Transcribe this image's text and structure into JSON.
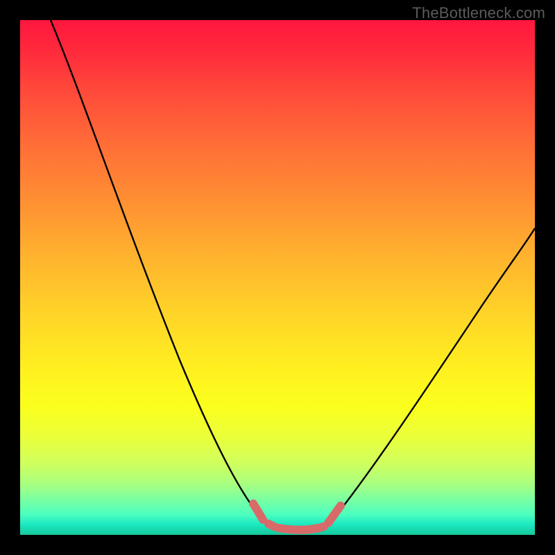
{
  "watermark": "TheBottleneck.com",
  "colors": {
    "curve_stroke": "#000000",
    "marker_stroke": "#d86a6a",
    "background": "#000000"
  },
  "chart_data": {
    "type": "line",
    "title": "",
    "xlabel": "",
    "ylabel": "",
    "xlim": [
      0,
      100
    ],
    "ylim": [
      0,
      100
    ],
    "grid": false,
    "series": [
      {
        "name": "left-curve",
        "x": [
          6,
          10,
          15,
          20,
          25,
          30,
          35,
          40,
          45,
          48
        ],
        "y": [
          100,
          89,
          78,
          67,
          55,
          43,
          31,
          19,
          7,
          2
        ]
      },
      {
        "name": "bottom-flat",
        "x": [
          48,
          52,
          56,
          60
        ],
        "y": [
          2,
          1.5,
          1.5,
          2
        ]
      },
      {
        "name": "right-curve",
        "x": [
          60,
          65,
          70,
          75,
          80,
          85,
          90,
          95,
          100
        ],
        "y": [
          2,
          8,
          15,
          22,
          30,
          38,
          46,
          53,
          60
        ]
      }
    ],
    "markers": [
      {
        "segment": "left-end",
        "x": [
          46,
          47,
          48
        ],
        "y": [
          5,
          3.5,
          2
        ]
      },
      {
        "segment": "bottom",
        "x": [
          50,
          52,
          54,
          56,
          58
        ],
        "y": [
          1.8,
          1.6,
          1.5,
          1.6,
          1.8
        ]
      },
      {
        "segment": "right-start",
        "x": [
          60,
          61,
          62
        ],
        "y": [
          2,
          3,
          4
        ]
      }
    ],
    "marker_style": {
      "shape": "rounded-dash",
      "color": "#d86a6a",
      "width": 12
    },
    "legend": false
  }
}
